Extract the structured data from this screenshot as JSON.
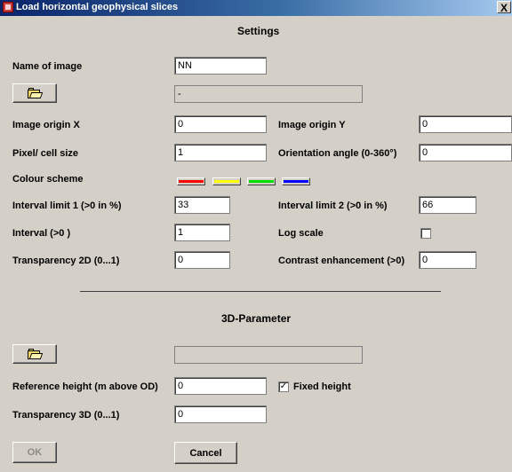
{
  "window": {
    "title": "Load horizontal geophysical slices",
    "close_label": "X"
  },
  "settings": {
    "heading": "Settings",
    "name_of_image": {
      "label": "Name of image",
      "value": "NN"
    },
    "path_field": {
      "value": "-"
    },
    "image_origin_x": {
      "label": "Image origin X",
      "value": "0"
    },
    "image_origin_y": {
      "label": "Image origin Y",
      "value": "0"
    },
    "pixel_cell_size": {
      "label": "Pixel/ cell size",
      "value": "1"
    },
    "orientation_angle": {
      "label": "Orientation angle (0-360°)",
      "value": "0"
    },
    "colour_scheme": {
      "label": "Colour scheme",
      "colors": [
        "#ff0000",
        "#ffff00",
        "#00e000",
        "#0000ff"
      ]
    },
    "interval_limit_1": {
      "label": "Interval limit 1 (>0 in %)",
      "value": "33"
    },
    "interval_limit_2": {
      "label": "Interval limit 2 (>0 in %)",
      "value": "66"
    },
    "interval": {
      "label": "Interval (>0 )",
      "value": "1"
    },
    "log_scale": {
      "label": "Log scale",
      "checked": false
    },
    "transparency_2d": {
      "label": "Transparency 2D (0...1)",
      "value": "0"
    },
    "contrast_enhancement": {
      "label": "Contrast enhancement (>0)",
      "value": "0"
    }
  },
  "parameter_3d": {
    "heading": "3D-Parameter",
    "path_field": {
      "value": ""
    },
    "reference_height": {
      "label": "Reference height (m above OD)",
      "value": "0"
    },
    "fixed_height": {
      "label": "Fixed height",
      "checked": true,
      "check_mark": "✓"
    },
    "transparency_3d": {
      "label": "Transparency 3D (0...1)",
      "value": "0"
    }
  },
  "buttons": {
    "ok": "OK",
    "cancel": "Cancel"
  },
  "icons": {
    "open_folder": "open-folder-icon"
  }
}
